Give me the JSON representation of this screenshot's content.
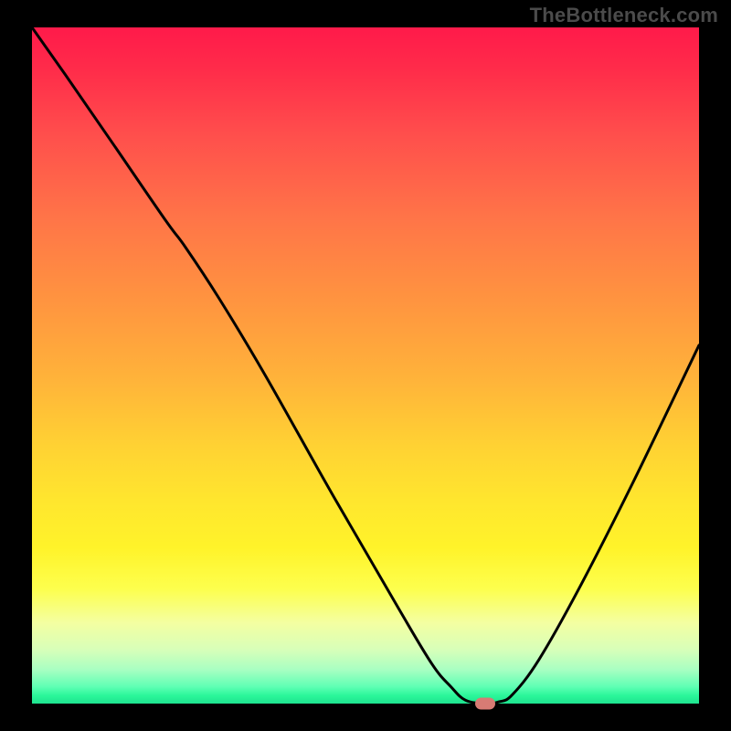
{
  "watermark": "TheBottleneck.com",
  "colors": {
    "frame_bg": "#000000",
    "curve_stroke": "#000000",
    "marker_fill": "#d77b74"
  },
  "chart_data": {
    "type": "line",
    "title": "",
    "xlabel": "",
    "ylabel": "",
    "xlim": [
      0,
      100
    ],
    "ylim": [
      0,
      100
    ],
    "background_gradient": {
      "direction": "top-to-bottom",
      "stops": [
        {
          "pct": 0,
          "color": "#ff1a4a"
        },
        {
          "pct": 40,
          "color": "#ff9340"
        },
        {
          "pct": 70,
          "color": "#ffe62e"
        },
        {
          "pct": 92,
          "color": "#d8ffb9"
        },
        {
          "pct": 100,
          "color": "#1ee28f"
        }
      ]
    },
    "series": [
      {
        "name": "bottleneck-curve",
        "x": [
          0.0,
          5.0,
          12.0,
          20.0,
          23.0,
          28.0,
          35.0,
          45.0,
          55.0,
          60.0,
          62.8,
          65.0,
          68.0,
          70.0,
          72.0,
          76.0,
          82.0,
          90.0,
          100.0
        ],
        "y": [
          100.0,
          93.0,
          83.0,
          71.5,
          67.5,
          60.0,
          48.5,
          31.0,
          14.0,
          5.8,
          2.5,
          0.5,
          0.0,
          0.25,
          1.3,
          6.5,
          17.0,
          32.5,
          53.0
        ]
      }
    ],
    "marker": {
      "x": 68.0,
      "y": 0.0
    }
  }
}
